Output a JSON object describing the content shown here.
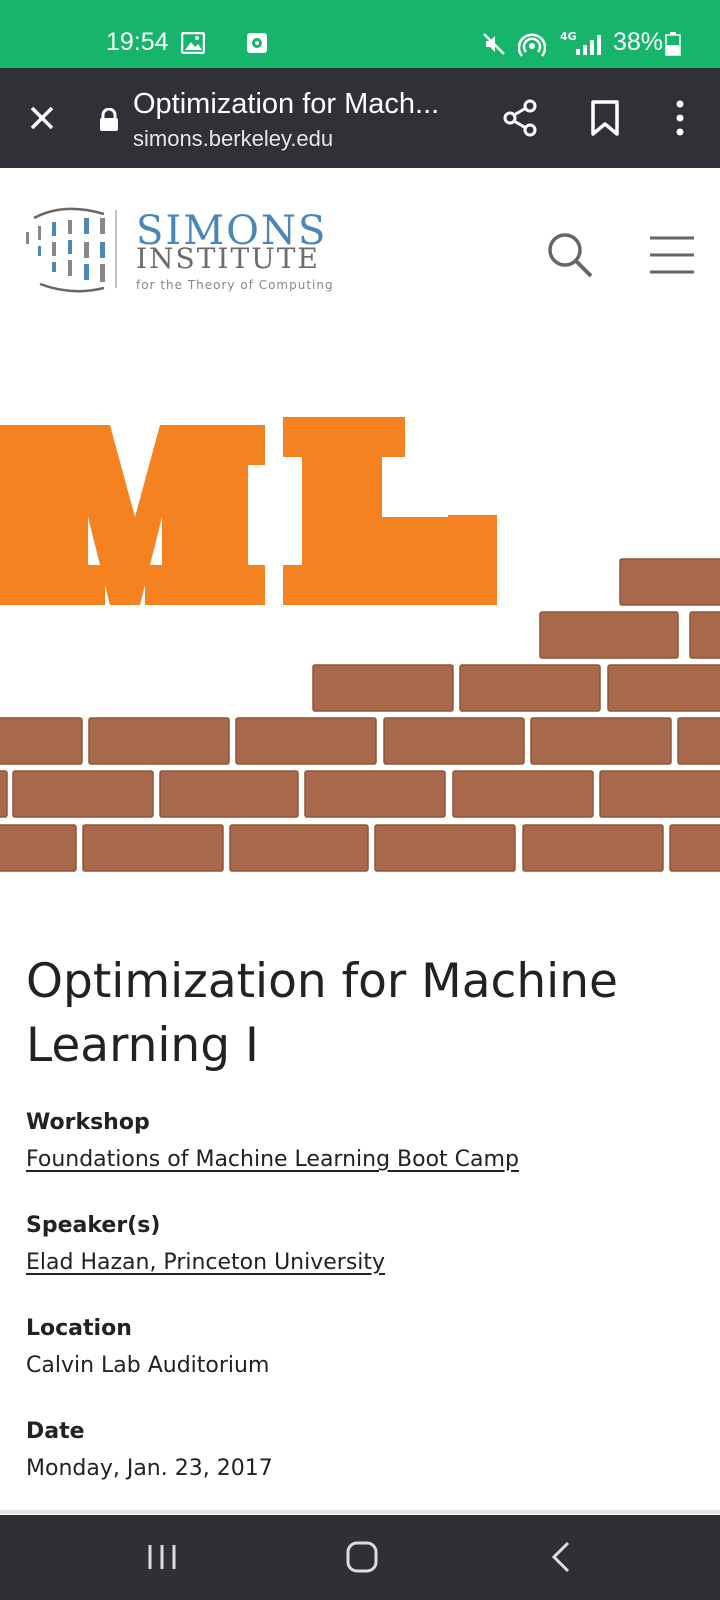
{
  "status_bar": {
    "time": "19:54",
    "network": "4G",
    "battery": "38%"
  },
  "browser": {
    "page_title": "Optimization for Mach...",
    "url": "simons.berkeley.edu"
  },
  "site": {
    "brand_line1": "SIMONS",
    "brand_line2": "INSTITUTE",
    "brand_line3": "for the Theory of Computing"
  },
  "banner": {
    "text": "ML",
    "colors": {
      "text": "#f58220",
      "brick": "#a8694a"
    }
  },
  "event": {
    "title": "Optimization for Machine Learning I",
    "workshop_label": "Workshop",
    "workshop_value": "Foundations of Machine Learning Boot Camp",
    "speakers_label": "Speaker(s)",
    "speakers_value": "Elad Hazan, Princeton University",
    "location_label": "Location",
    "location_value": "Calvin Lab Auditorium",
    "date_label": "Date",
    "date_value": "Monday, Jan. 23, 2017"
  },
  "colors": {
    "status_bar": "#17b56c",
    "toolbar": "#2f3136",
    "nav_bar": "#2e3035",
    "brand_blue": "#4a86b8"
  }
}
